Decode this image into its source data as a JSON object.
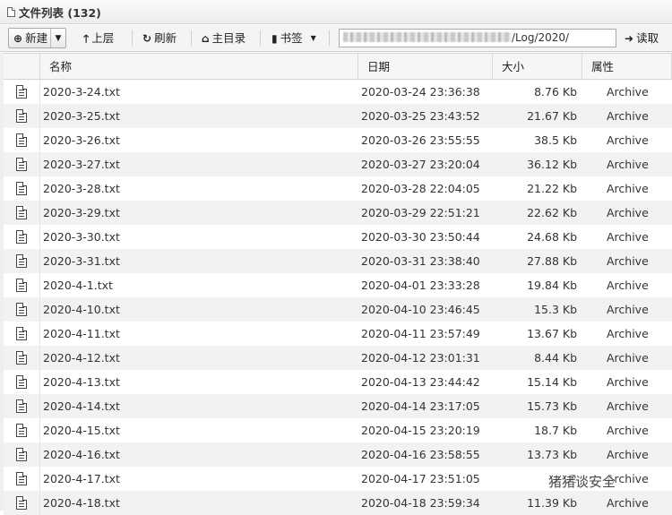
{
  "panel": {
    "title": "文件列表 (132)"
  },
  "toolbar": {
    "new_label": "新建",
    "up_label": "上层",
    "refresh_label": "刷新",
    "home_label": "主目录",
    "bookmark_label": "书签",
    "path_visible_suffix": "/Log/2020/",
    "read_label": "读取"
  },
  "columns": {
    "name": "名称",
    "date": "日期",
    "size": "大小",
    "attr": "属性"
  },
  "files": [
    {
      "name": "2020-3-24.txt",
      "date": "2020-03-24 23:36:38",
      "size": "8.76 Kb",
      "attr": "Archive"
    },
    {
      "name": "2020-3-25.txt",
      "date": "2020-03-25 23:43:52",
      "size": "21.67 Kb",
      "attr": "Archive"
    },
    {
      "name": "2020-3-26.txt",
      "date": "2020-03-26 23:55:55",
      "size": "38.5 Kb",
      "attr": "Archive"
    },
    {
      "name": "2020-3-27.txt",
      "date": "2020-03-27 23:20:04",
      "size": "36.12 Kb",
      "attr": "Archive"
    },
    {
      "name": "2020-3-28.txt",
      "date": "2020-03-28 22:04:05",
      "size": "21.22 Kb",
      "attr": "Archive"
    },
    {
      "name": "2020-3-29.txt",
      "date": "2020-03-29 22:51:21",
      "size": "22.62 Kb",
      "attr": "Archive"
    },
    {
      "name": "2020-3-30.txt",
      "date": "2020-03-30 23:50:44",
      "size": "24.68 Kb",
      "attr": "Archive"
    },
    {
      "name": "2020-3-31.txt",
      "date": "2020-03-31 23:38:40",
      "size": "27.88 Kb",
      "attr": "Archive"
    },
    {
      "name": "2020-4-1.txt",
      "date": "2020-04-01 23:33:28",
      "size": "19.84 Kb",
      "attr": "Archive"
    },
    {
      "name": "2020-4-10.txt",
      "date": "2020-04-10 23:46:45",
      "size": "15.3 Kb",
      "attr": "Archive"
    },
    {
      "name": "2020-4-11.txt",
      "date": "2020-04-11 23:57:49",
      "size": "13.67 Kb",
      "attr": "Archive"
    },
    {
      "name": "2020-4-12.txt",
      "date": "2020-04-12 23:01:31",
      "size": "8.44 Kb",
      "attr": "Archive"
    },
    {
      "name": "2020-4-13.txt",
      "date": "2020-04-13 23:44:42",
      "size": "15.14 Kb",
      "attr": "Archive"
    },
    {
      "name": "2020-4-14.txt",
      "date": "2020-04-14 23:17:05",
      "size": "15.73 Kb",
      "attr": "Archive"
    },
    {
      "name": "2020-4-15.txt",
      "date": "2020-04-15 23:20:19",
      "size": "18.7 Kb",
      "attr": "Archive"
    },
    {
      "name": "2020-4-16.txt",
      "date": "2020-04-16 23:58:55",
      "size": "13.73 Kb",
      "attr": "Archive"
    },
    {
      "name": "2020-4-17.txt",
      "date": "2020-04-17 23:51:05",
      "size": "2",
      "attr": "Archive"
    },
    {
      "name": "2020-4-18.txt",
      "date": "2020-04-18 23:59:34",
      "size": "11.39 Kb",
      "attr": "Archive"
    }
  ],
  "watermark": "猪猪谈安全"
}
